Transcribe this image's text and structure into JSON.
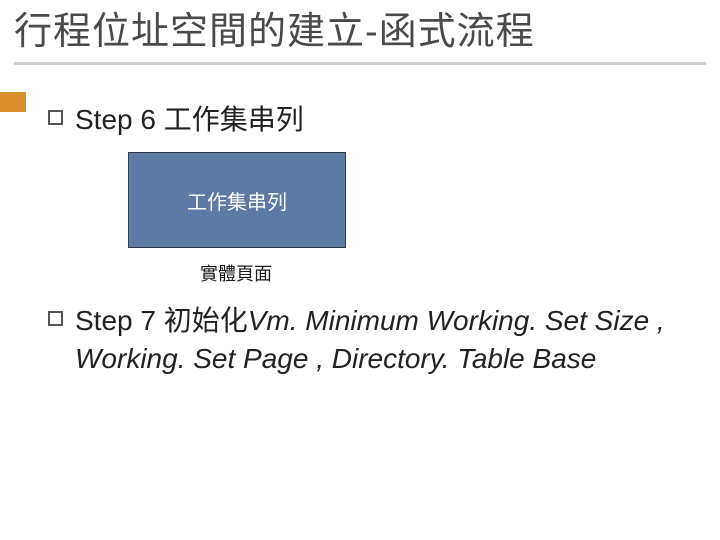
{
  "title": "行程位址空間的建立-函式流程",
  "step6": {
    "label": "Step 6 工作集串列",
    "box_label": "工作集串列",
    "caption": "實體頁面"
  },
  "step7": {
    "prefix": "Step 7 初始化",
    "italic": "Vm. Minimum Working. Set Size , Working. Set Page , Directory. Table Base"
  }
}
